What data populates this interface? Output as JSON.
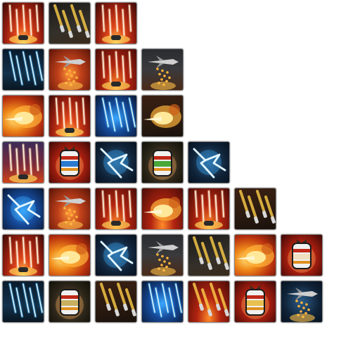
{
  "sheet": {
    "background": "#ffffff",
    "rows": [
      [
        {
          "icon": "rockets-red-icon",
          "bg": "bg-red-flare"
        },
        {
          "icon": "missile-barrage-gold-icon",
          "bg": "bg-dark-gold"
        },
        {
          "icon": "rockets-red-icon",
          "bg": "bg-red-flare"
        }
      ],
      [
        {
          "icon": "blue-streaks-icon",
          "bg": "bg-dark-blue"
        },
        {
          "icon": "jet-bombing-icon",
          "bg": "bg-jet-red"
        },
        {
          "icon": "rockets-red-icon",
          "bg": "bg-red-dark"
        },
        {
          "icon": "jet-bombing-icon",
          "bg": "bg-jet"
        }
      ],
      [
        {
          "icon": "fire-blast-icon",
          "bg": "bg-fire"
        },
        {
          "icon": "rockets-red-icon",
          "bg": "bg-red-flare"
        },
        {
          "icon": "blue-streaks-icon",
          "bg": "bg-blue-bolt"
        },
        {
          "icon": "fire-blast-icon",
          "bg": "bg-shells"
        }
      ],
      [
        {
          "icon": "rockets-purple-icon",
          "bg": "bg-purple"
        },
        {
          "icon": "bomb-icon",
          "bg": "bg-bomb",
          "stripe": "#2a7ad0"
        },
        {
          "icon": "lightning-icon",
          "bg": "bg-storm"
        },
        {
          "icon": "bomb-icon",
          "bg": "bg-bomb-dark",
          "stripe": "#4aa83a"
        },
        {
          "icon": "lightning-icon",
          "bg": "bg-storm"
        }
      ],
      [
        {
          "icon": "lightning-icon",
          "bg": "bg-blue-bolt"
        },
        {
          "icon": "jet-bombing-icon",
          "bg": "bg-jet-red"
        },
        {
          "icon": "rockets-red-icon",
          "bg": "bg-red-dark"
        },
        {
          "icon": "fire-blast-icon",
          "bg": "bg-red-dark"
        },
        {
          "icon": "rockets-red-icon",
          "bg": "bg-red-dark"
        },
        {
          "icon": "missile-barrage-gold-icon",
          "bg": "bg-shells"
        }
      ],
      [
        {
          "icon": "rockets-red-icon",
          "bg": "bg-red-flare"
        },
        {
          "icon": "fire-blast-icon",
          "bg": "bg-fire"
        },
        {
          "icon": "lightning-icon",
          "bg": "bg-storm"
        },
        {
          "icon": "jet-bombing-icon",
          "bg": "bg-jet"
        },
        {
          "icon": "missile-barrage-gold-icon",
          "bg": "bg-dark-gold"
        },
        {
          "icon": "fire-blast-icon",
          "bg": "bg-fire"
        },
        {
          "icon": "bomb-icon",
          "bg": "bg-bomb",
          "stripe": "#f0e0c0"
        }
      ],
      [
        {
          "icon": "blue-streaks-icon",
          "bg": "bg-dark-blue"
        },
        {
          "icon": "bomb-icon",
          "bg": "bg-bomb-dark",
          "stripe": "#c8b060"
        },
        {
          "icon": "missile-barrage-gold-icon",
          "bg": "bg-shells"
        },
        {
          "icon": "blue-streaks-icon",
          "bg": "bg-blue-bolt"
        },
        {
          "icon": "missile-barrage-gold-icon",
          "bg": "bg-red-dark"
        },
        {
          "icon": "bomb-icon",
          "bg": "bg-bomb",
          "stripe": "#e8c050"
        },
        {
          "icon": "jet-bombing-icon",
          "bg": "bg-storm"
        }
      ]
    ]
  }
}
